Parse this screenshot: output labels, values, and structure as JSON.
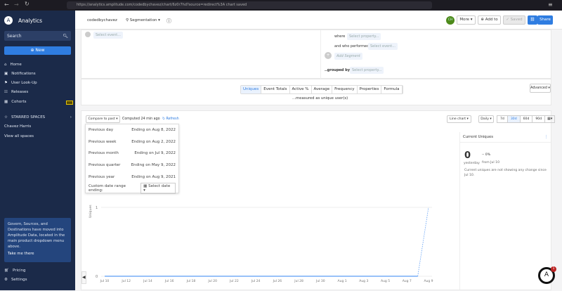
{
  "browser": {
    "url": "https://analytics.amplitude.com/codedbychavez/chart/6z0r7hd?source=redirect%3A chart saved",
    "back": "←",
    "forward": "→",
    "reload": "↻"
  },
  "sidebar": {
    "app": "Analytics",
    "search_placeholder": "Search",
    "new_label": "New",
    "items": [
      {
        "label": "Home",
        "icon": "home-icon"
      },
      {
        "label": "Notifications",
        "icon": "lock-icon"
      },
      {
        "label": "User Look-Up",
        "icon": "user-lookup-icon"
      },
      {
        "label": "Releases",
        "icon": "releases-icon"
      },
      {
        "label": "Cohorts",
        "icon": "cohorts-icon"
      }
    ],
    "starred_title": "STARRED SPACES",
    "starred": [
      "Chavez Harris",
      "View all spaces"
    ],
    "notice": "Govern, Sources, and Destinations have moved into Amplitude Data, located in the main product dropdown menu above.",
    "notice_link": "Take me there",
    "footer": [
      {
        "label": "Pricing",
        "icon": "cart-icon"
      },
      {
        "label": "Settings",
        "icon": "gear-icon"
      }
    ]
  },
  "header": {
    "org": "codedbychavez",
    "chart_type": "Segmentation",
    "avatar": "CH",
    "more": "More",
    "add_to": "Add to",
    "saved": "Saved",
    "share": "Share"
  },
  "events": {
    "select_event": "Select event...",
    "where": "where",
    "select_property": "Select property...",
    "and_who": "and who performed",
    "select_event2": "Select event...",
    "add_segment": "Add Segment",
    "grouped_by": "..grouped by",
    "group_property": "Select property..."
  },
  "metrics": {
    "tabs": [
      "Uniques",
      "Event Totals",
      "Active %",
      "Average",
      "Frequency",
      "Properties",
      "Formula"
    ],
    "active": "Uniques",
    "measured": "...measured as unique user(s)",
    "advanced": "Advanced"
  },
  "chart_toolbar": {
    "compare": "Compare to past",
    "computed": "Computed 24 min ago",
    "refresh": "Refresh",
    "chart_kind": "Line chart",
    "interval": "Daily",
    "ranges": [
      "7d",
      "30d",
      "60d",
      "90d"
    ],
    "active_range": "30d"
  },
  "compare_menu": {
    "rows": [
      {
        "label": "Previous day",
        "value": "Ending on Aug 8, 2022"
      },
      {
        "label": "Previous week",
        "value": "Ending on Aug 2, 2022"
      },
      {
        "label": "Previous month",
        "value": "Ending on Jul 9, 2022"
      },
      {
        "label": "Previous quarter",
        "value": "Ending on May 9, 2022"
      },
      {
        "label": "Previous year",
        "value": "Ending on Aug 9, 2021"
      }
    ],
    "custom_label": "Custom date range ending:",
    "select_date": "Select date"
  },
  "current": {
    "title": "Current Uniques",
    "value": "0",
    "period": "yesterday",
    "change": "-- 0%",
    "from": "from Jul 10",
    "note": "Current uniques are not showing any change since Jul 10."
  },
  "chart_data": {
    "type": "line",
    "ylabel": "Uniques",
    "ylim": [
      0,
      1
    ],
    "yticks": [
      "0",
      "1"
    ],
    "x": [
      "Jul 10",
      "Jul 11",
      "Jul 12",
      "Jul 13",
      "Jul 14",
      "Jul 15",
      "Jul 16",
      "Jul 17",
      "Jul 18",
      "Jul 19",
      "Jul 20",
      "Jul 21",
      "Jul 22",
      "Jul 23",
      "Jul 24",
      "Jul 25",
      "Jul 26",
      "Jul 27",
      "Jul 28",
      "Jul 29",
      "Jul 30",
      "Jul 31",
      "Aug 1",
      "Aug 2",
      "Aug 3",
      "Aug 4",
      "Aug 5",
      "Aug 6",
      "Aug 7",
      "Aug 8",
      "Aug 9"
    ],
    "values": [
      0,
      0,
      0,
      0,
      0,
      0,
      0,
      0,
      0,
      0,
      0,
      0,
      0,
      0,
      0,
      0,
      0,
      0,
      0,
      0,
      0,
      0,
      0,
      0,
      0,
      0,
      0,
      0,
      0,
      0,
      1
    ],
    "incomplete_last_point": true,
    "xtick_labels": [
      "Jul 10",
      "Jul 12",
      "Jul 14",
      "Jul 16",
      "Jul 18",
      "Jul 20",
      "Jul 22",
      "Jul 24",
      "Jul 26",
      "Jul 28",
      "Jul 30",
      "Aug 1",
      "Aug 3",
      "Aug 5",
      "Aug 7",
      "Aug 9"
    ],
    "color": "#5b9cf5"
  },
  "chat_badge": "1"
}
